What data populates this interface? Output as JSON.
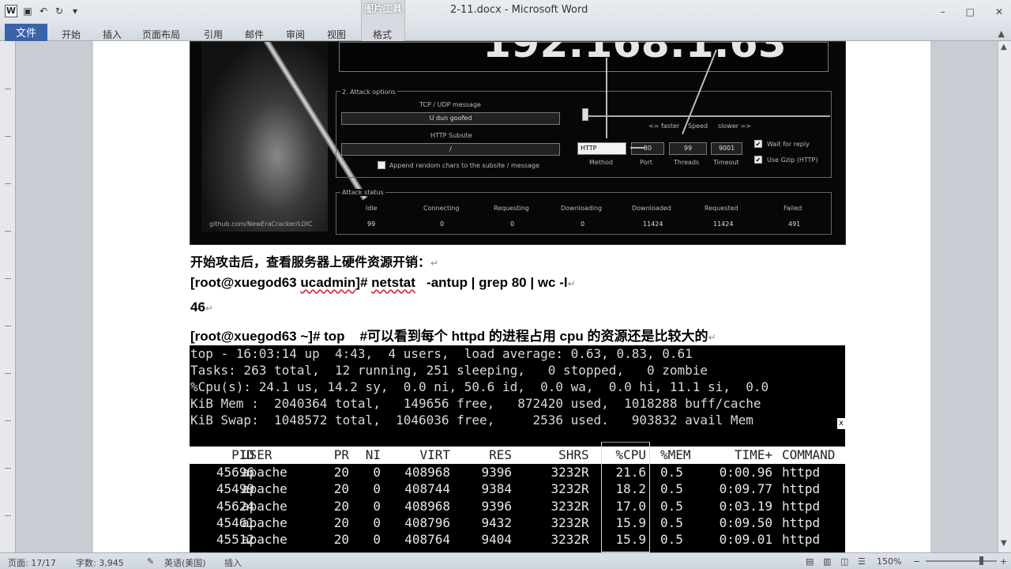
{
  "window": {
    "title": "2-11.docx - Microsoft Word",
    "context_tab_group": "图片工具",
    "controls": [
      "–",
      "□",
      "✕"
    ]
  },
  "quick_access": {
    "app_icon": "W",
    "icons": [
      "save-icon",
      "undo-icon",
      "redo-icon",
      "customize-icon"
    ]
  },
  "ribbon": {
    "file_tab": "文件",
    "tabs": [
      "开始",
      "插入",
      "页面布局",
      "引用",
      "邮件",
      "审阅",
      "视图",
      "格式"
    ]
  },
  "loic": {
    "ip_display": "192.168.1.63",
    "credit": "github.com/NewEraCracker/LOIC",
    "attack_options_title": "2. Attack options",
    "tcp_udp_label": "TCP / UDP message",
    "tcp_udp_value": "U dun goofed",
    "http_subsite_label": "HTTP Subsite",
    "http_subsite_value": "/",
    "append_random_label": "Append random chars to the subsite / message",
    "speed_faster": "<= faster",
    "speed_label": "Speed",
    "speed_slower": "slower =>",
    "method_value": "HTTP",
    "method_label": "Method",
    "port_value": "80",
    "port_label": "Port",
    "threads_value": "99",
    "threads_label": "Threads",
    "timeout_value": "9001",
    "timeout_label": "Timeout",
    "wait_for_reply": "Wait for reply",
    "use_gzip": "Use Gzip (HTTP)",
    "status_title": "Attack status",
    "status_headers": [
      "Idle",
      "Connecting",
      "Requesting",
      "Downloading",
      "Downloaded",
      "Requested",
      "Failed"
    ],
    "status_values": [
      "99",
      "0",
      "0",
      "0",
      "11424",
      "11424",
      "491"
    ]
  },
  "document": {
    "line1": "开始攻击后，查看服务器上硬件资源开销：",
    "line2_prompt": "[root@xuegod63 ",
    "line2_dir": "ucadmin",
    "line2_hash": "]# ",
    "line2_cmd": "netstat",
    "line2_rest": "   -antup | grep 80 | wc -l",
    "line3": "46",
    "line4": "[root@xuegod63 ~]# top    #可以看到每个 httpd 的进程占用 cpu 的资源还是比较大的",
    "para_mark": "↵"
  },
  "terminal": {
    "summary": [
      "top - 16:03:14 up  4:43,  4 users,  load average: 0.63, 0.83, 0.61",
      "Tasks: 263 total,  12 running, 251 sleeping,   0 stopped,   0 zombie",
      "%Cpu(s): 24.1 us, 14.2 sy,  0.0 ni, 50.6 id,  0.0 wa,  0.0 hi, 11.1 si,  0.0",
      "KiB Mem :  2040364 total,   149656 free,   872420 used,  1018288 buff/cache",
      "KiB Swap:  1048572 total,  1046036 free,     2536 used.   903832 avail Mem"
    ],
    "scroll_glyph": "x",
    "columns": [
      "PID",
      "USER",
      "PR",
      "NI",
      "VIRT",
      "RES",
      "SHR",
      "S",
      "%CPU",
      "%MEM",
      "TIME+",
      "COMMAND"
    ],
    "rows": [
      [
        "45696",
        "apache",
        "20",
        "0",
        "408968",
        "9396",
        "3232",
        "R",
        "21.6",
        "0.5",
        "0:00.96",
        "httpd"
      ],
      [
        "45499",
        "apache",
        "20",
        "0",
        "408744",
        "9384",
        "3232",
        "R",
        "18.2",
        "0.5",
        "0:09.77",
        "httpd"
      ],
      [
        "45624",
        "apache",
        "20",
        "0",
        "408968",
        "9396",
        "3232",
        "R",
        "17.0",
        "0.5",
        "0:03.19",
        "httpd"
      ],
      [
        "45461",
        "apache",
        "20",
        "0",
        "408796",
        "9432",
        "3232",
        "R",
        "15.9",
        "0.5",
        "0:09.50",
        "httpd"
      ],
      [
        "45512",
        "apache",
        "20",
        "0",
        "408764",
        "9404",
        "3232",
        "R",
        "15.9",
        "0.5",
        "0:09.01",
        "httpd"
      ]
    ]
  },
  "status_bar": {
    "page": "页面: 17/17",
    "words": "字数: 3,945",
    "language": "英语(美国)",
    "mode": "插入",
    "zoom": "150%"
  }
}
